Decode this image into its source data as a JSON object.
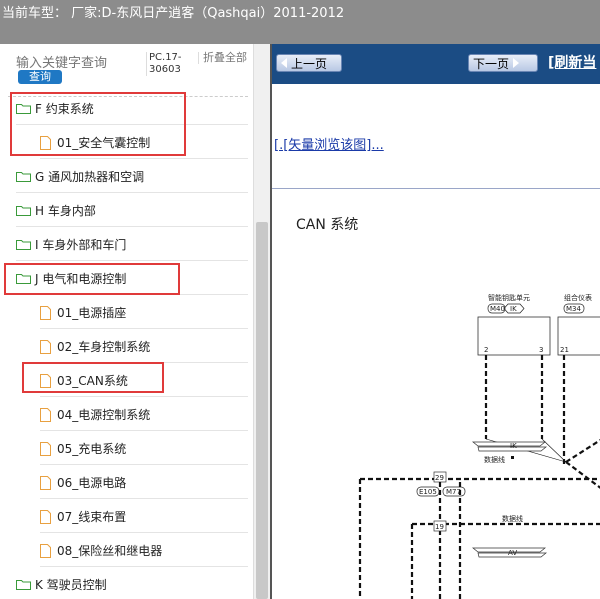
{
  "titlebar": {
    "text": "当前车型： 厂家:D-东风日产逍客（Qashqai）2011-2012"
  },
  "search": {
    "placeholder": "输入关键字查询",
    "button_label": "查询",
    "pc_info": "PC.17-30603",
    "collapse_label": "折叠全部"
  },
  "tree": {
    "items": [
      {
        "label": "F 约束系统",
        "type": "folder"
      },
      {
        "label": "01_安全气囊控制",
        "type": "file"
      },
      {
        "label": "G 通风加热器和空调",
        "type": "folder"
      },
      {
        "label": "H 车身内部",
        "type": "folder"
      },
      {
        "label": "I 车身外部和车门",
        "type": "folder"
      },
      {
        "label": "J 电气和电源控制",
        "type": "folder"
      },
      {
        "label": "01_电源插座",
        "type": "file"
      },
      {
        "label": "02_车身控制系统",
        "type": "file"
      },
      {
        "label": "03_CAN系统",
        "type": "file"
      },
      {
        "label": "04_电源控制系统",
        "type": "file"
      },
      {
        "label": "05_充电系统",
        "type": "file"
      },
      {
        "label": "06_电源电路",
        "type": "file"
      },
      {
        "label": "07_线束布置",
        "type": "file"
      },
      {
        "label": "08_保险丝和继电器",
        "type": "file"
      },
      {
        "label": "K 驾驶员控制",
        "type": "folder"
      }
    ]
  },
  "nav": {
    "prev_label": "上一页",
    "next_label": "下一页",
    "refresh_label": "[刷新当",
    "vector_link": "[.[矢量浏览该图]..."
  },
  "diagram": {
    "title": "CAN 系统",
    "unit1_name": "智能钥匙单元",
    "unit1_code_a": "M40",
    "unit1_code_b": "IK",
    "unit2_name": "组合仪表",
    "unit2_code": "M34",
    "pin_2": "2",
    "pin_3": "3",
    "pin_21": "21",
    "data_line_1": "数据线",
    "data_line_2": "数据线",
    "ik_label": "IK",
    "av_label": "AV",
    "pin_29": "29",
    "pin_19": "19",
    "conn_e105": "E105",
    "conn_m77": "M77"
  },
  "colors": {
    "folder": "#3a9a3a",
    "file": "#e8a040",
    "highlight": "#e03a3a",
    "navbar": "#1b4c84"
  }
}
